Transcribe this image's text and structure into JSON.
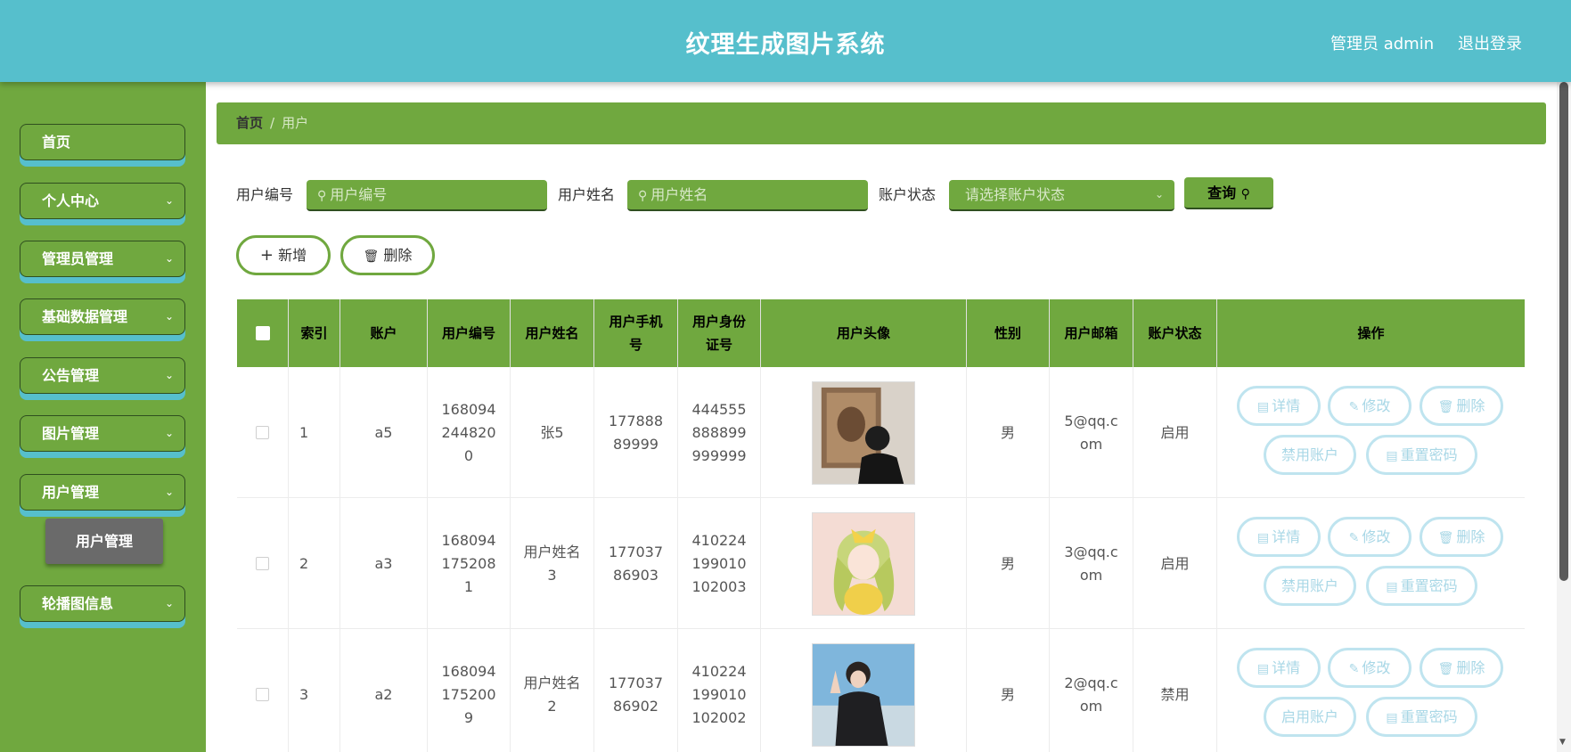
{
  "header": {
    "title": "纹理生成图片系统",
    "user": "管理员 admin",
    "logout": "退出登录"
  },
  "sidebar": {
    "items": [
      {
        "label": "首页",
        "expandable": false
      },
      {
        "label": "个人中心",
        "expandable": true
      },
      {
        "label": "管理员管理",
        "expandable": true
      },
      {
        "label": "基础数据管理",
        "expandable": true
      },
      {
        "label": "公告管理",
        "expandable": true
      },
      {
        "label": "图片管理",
        "expandable": true
      },
      {
        "label": "用户管理",
        "expandable": true
      },
      {
        "label": "轮播图信息",
        "expandable": true
      }
    ],
    "active_sub": "用户管理"
  },
  "breadcrumb": {
    "home": "首页",
    "separator": "/",
    "current": "用户"
  },
  "search": {
    "user_no_label": "用户编号",
    "user_no_placeholder": "用户编号",
    "user_name_label": "用户姓名",
    "user_name_placeholder": "用户姓名",
    "status_label": "账户状态",
    "status_placeholder": "请选择账户状态",
    "query_label": "查询"
  },
  "actions": {
    "add": "新增",
    "delete": "删除"
  },
  "table": {
    "columns": [
      "索引",
      "账户",
      "用户编号",
      "用户姓名",
      "用户手机号",
      "用户身份证号",
      "用户头像",
      "性别",
      "用户邮箱",
      "账户状态",
      "操作"
    ],
    "rows": [
      {
        "index": "1",
        "account": "a5",
        "user_no": "1680942448200",
        "name": "张5",
        "phone": "17788889999",
        "id_card": "444555888899999999",
        "gender": "男",
        "email": "5@qq.com",
        "status": "启用",
        "toggle_label": "禁用账户"
      },
      {
        "index": "2",
        "account": "a3",
        "user_no": "1680941752081",
        "name": "用户姓名3",
        "phone": "17703786903",
        "id_card": "410224199010102003",
        "gender": "男",
        "email": "3@qq.com",
        "status": "启用",
        "toggle_label": "禁用账户"
      },
      {
        "index": "3",
        "account": "a2",
        "user_no": "1680941752009",
        "name": "用户姓名2",
        "phone": "17703786902",
        "id_card": "410224199010102002",
        "gender": "男",
        "email": "2@qq.com",
        "status": "禁用",
        "toggle_label": "启用账户"
      }
    ],
    "row_ops": {
      "detail": "详情",
      "edit": "修改",
      "delete": "删除",
      "reset": "重置密码"
    }
  },
  "colors": {
    "header": "#56bfcc",
    "primary_green": "#70a83f",
    "menu_underline": "#56bfcc",
    "op_button": "#a8d7e6"
  }
}
